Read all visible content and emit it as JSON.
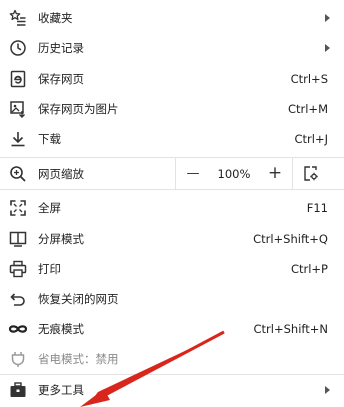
{
  "menu": {
    "items": [
      {
        "label": "收藏夹",
        "icon": "star-list-icon"
      },
      {
        "label": "历史记录",
        "icon": "clock-icon"
      },
      {
        "label": "保存网页",
        "shortcut": "Ctrl+S",
        "icon": "e-page-icon"
      },
      {
        "label": "保存网页为图片",
        "shortcut": "Ctrl+M",
        "icon": "image-save-icon"
      },
      {
        "label": "下载",
        "shortcut": "Ctrl+J",
        "icon": "download-icon"
      },
      {
        "label": "网页缩放",
        "icon": "zoom-icon"
      },
      {
        "label": "全屏",
        "shortcut": "F11",
        "icon": "fullscreen-icon"
      },
      {
        "label": "分屏模式",
        "shortcut": "Ctrl+Shift+Q",
        "icon": "split-screen-icon"
      },
      {
        "label": "打印",
        "shortcut": "Ctrl+P",
        "icon": "printer-icon"
      },
      {
        "label": "恢复关闭的网页",
        "icon": "undo-icon"
      },
      {
        "label": "无痕模式",
        "shortcut": "Ctrl+Shift+N",
        "icon": "incognito-icon"
      },
      {
        "label": "省电模式：禁用",
        "icon": "power-save-icon",
        "disabled": true
      },
      {
        "label": "更多工具",
        "icon": "toolbox-icon"
      }
    ],
    "zoom": {
      "minus": "—",
      "value": "100%",
      "plus": "+"
    }
  },
  "colors": {
    "annotation_arrow": "#d9261c",
    "divider": "#e3e3e3",
    "text": "#222222",
    "disabled_text": "#8a8a8a"
  }
}
